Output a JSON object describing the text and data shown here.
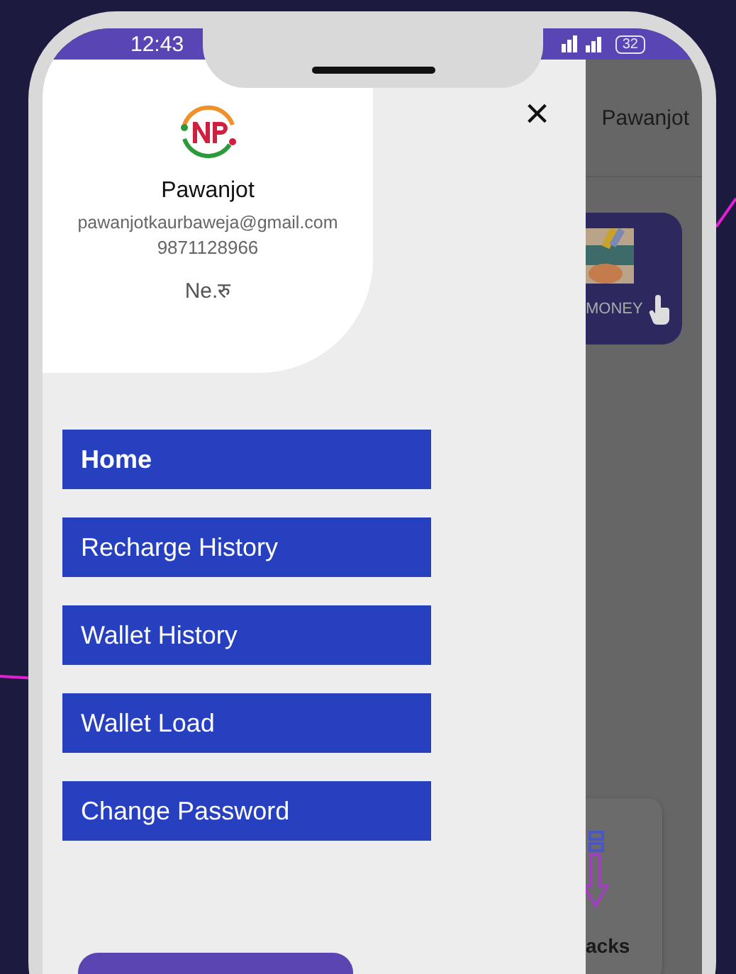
{
  "status_bar": {
    "time": "12:43",
    "battery": "32"
  },
  "drawer": {
    "user_name": "Pawanjot",
    "email": "pawanjotkaurbaweja@gmail.com",
    "phone": "9871128966",
    "balance": "Ne.रु",
    "close": "×",
    "menu_items": [
      {
        "label": "Home",
        "selected": true
      },
      {
        "label": "Recharge History",
        "selected": false
      },
      {
        "label": "Wallet History",
        "selected": false
      },
      {
        "label": "Wallet Load",
        "selected": false
      },
      {
        "label": "Change Password",
        "selected": false
      }
    ]
  },
  "background_app": {
    "user_name": "Pawanjot",
    "card_label": "MONEY",
    "tile_label": "acks"
  }
}
